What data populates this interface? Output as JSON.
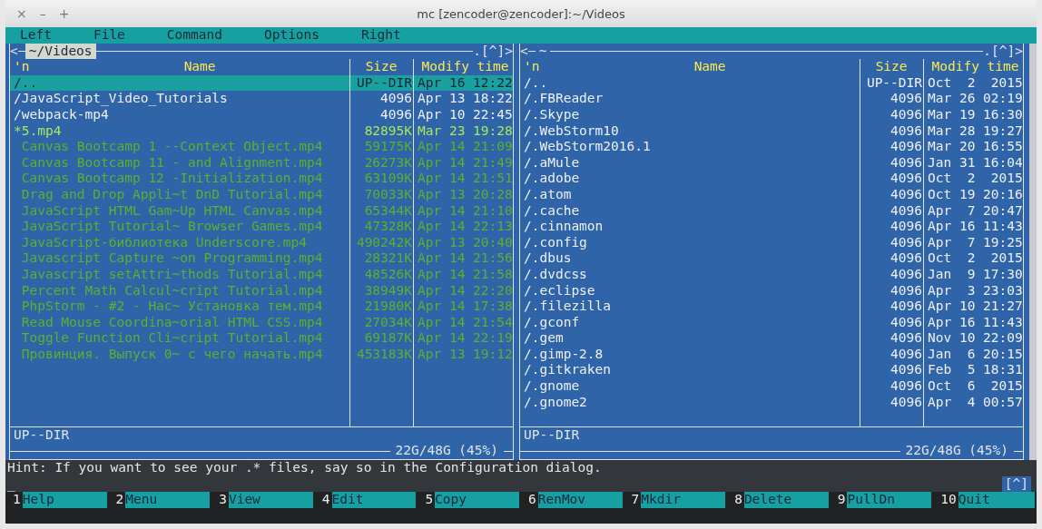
{
  "window": {
    "title": "mc [zencoder@zencoder]:~/Videos",
    "controls": [
      {
        "label": "×"
      },
      {
        "label": "–"
      },
      {
        "label": "+"
      }
    ]
  },
  "menu": [
    {
      "label": "Left"
    },
    {
      "label": "File"
    },
    {
      "label": "Command"
    },
    {
      "label": "Options"
    },
    {
      "label": "Right"
    }
  ],
  "panels": [
    {
      "path": "~/Videos",
      "active": true,
      "back": "<",
      "history": ".[^]",
      "forward": ">",
      "columns": [
        "'n",
        "Name",
        "Size",
        "Modify time"
      ],
      "status": "UP--DIR",
      "disk": "22G/48G (45%)",
      "rows": [
        {
          "name": "/..",
          "size": "UP--DIR",
          "modified": "Apr 16 12:22",
          "kind": "directory",
          "selected": true
        },
        {
          "name": "/JavaScript_Video_Tutorials",
          "size": "4096",
          "modified": "Apr 13 18:22",
          "kind": "directory",
          "selected": false
        },
        {
          "name": "/webpack-mp4",
          "size": "4096",
          "modified": "Apr 10 22:45",
          "kind": "directory",
          "selected": false
        },
        {
          "name": "*5.mp4",
          "size": "82895K",
          "modified": "Mar 23 19:28",
          "kind": "executable",
          "selected": false
        },
        {
          "name": "Canvas Bootcamp 1 --Context Object.mp4",
          "size": "59175K",
          "modified": "Apr 14 21:09",
          "kind": "media",
          "selected": false
        },
        {
          "name": "Canvas Bootcamp 11 - and Alignment.mp4",
          "size": "26273K",
          "modified": "Apr 14 21:49",
          "kind": "media",
          "selected": false
        },
        {
          "name": "Canvas Bootcamp 12 -Initialization.mp4",
          "size": "63109K",
          "modified": "Apr 14 21:51",
          "kind": "media",
          "selected": false
        },
        {
          "name": "Drag and Drop Appli~t DnD Tutorial.mp4",
          "size": "70033K",
          "modified": "Apr 13 20:28",
          "kind": "media",
          "selected": false
        },
        {
          "name": "JavaScript HTML Gam~Up HTML Canvas.mp4",
          "size": "65344K",
          "modified": "Apr 14 21:10",
          "kind": "media",
          "selected": false
        },
        {
          "name": "JavaScript Tutorial~ Browser Games.mp4",
          "size": "47328K",
          "modified": "Apr 14 22:13",
          "kind": "media",
          "selected": false
        },
        {
          "name": "JavaScript-библиотека Underscore.mp4",
          "size": "490242K",
          "modified": "Apr 13 20:40",
          "kind": "media",
          "selected": false
        },
        {
          "name": "Javascript Capture ~on Programming.mp4",
          "size": "28321K",
          "modified": "Apr 14 21:56",
          "kind": "media",
          "selected": false
        },
        {
          "name": "Javascript setAttri~thods Tutorial.mp4",
          "size": "48526K",
          "modified": "Apr 14 21:58",
          "kind": "media",
          "selected": false
        },
        {
          "name": "Percent Math Calcul~cript Tutorial.mp4",
          "size": "38949K",
          "modified": "Apr 14 22:20",
          "kind": "media",
          "selected": false
        },
        {
          "name": "PhpStorm - #2 - Нас~ Установка тем.mp4",
          "size": "21980K",
          "modified": "Apr 14 17:38",
          "kind": "media",
          "selected": false
        },
        {
          "name": "Read Mouse Coordina~orial HTML CSS.mp4",
          "size": "27034K",
          "modified": "Apr 14 21:54",
          "kind": "media",
          "selected": false
        },
        {
          "name": "Toggle Function Cli~cript Tutorial.mp4",
          "size": "69187K",
          "modified": "Apr 14 22:19",
          "kind": "media",
          "selected": false
        },
        {
          "name": "Провинция. Выпуск 0~ с чего начать.mp4",
          "size": "453183K",
          "modified": "Apr 13 19:12",
          "kind": "media",
          "selected": false
        }
      ]
    },
    {
      "path": "~",
      "active": false,
      "back": "<",
      "history": ".[^]",
      "forward": ">",
      "columns": [
        "'n",
        "Name",
        "Size",
        "Modify time"
      ],
      "status": "UP--DIR",
      "disk": "22G/48G (45%)",
      "rows": [
        {
          "name": "/..",
          "size": "UP--DIR",
          "modified": "Oct  2  2015",
          "kind": "directory",
          "selected": false
        },
        {
          "name": "/.FBReader",
          "size": "4096",
          "modified": "Mar 26 02:19",
          "kind": "directory",
          "selected": false
        },
        {
          "name": "/.Skype",
          "size": "4096",
          "modified": "Mar 19 16:30",
          "kind": "directory",
          "selected": false
        },
        {
          "name": "/.WebStorm10",
          "size": "4096",
          "modified": "Mar 28 19:27",
          "kind": "directory",
          "selected": false
        },
        {
          "name": "/.WebStorm2016.1",
          "size": "4096",
          "modified": "Mar 20 16:55",
          "kind": "directory",
          "selected": false
        },
        {
          "name": "/.aMule",
          "size": "4096",
          "modified": "Jan 31 16:04",
          "kind": "directory",
          "selected": false
        },
        {
          "name": "/.adobe",
          "size": "4096",
          "modified": "Oct  2  2015",
          "kind": "directory",
          "selected": false
        },
        {
          "name": "/.atom",
          "size": "4096",
          "modified": "Oct 19 20:16",
          "kind": "directory",
          "selected": false
        },
        {
          "name": "/.cache",
          "size": "4096",
          "modified": "Apr  7 20:47",
          "kind": "directory",
          "selected": false
        },
        {
          "name": "/.cinnamon",
          "size": "4096",
          "modified": "Apr 16 11:43",
          "kind": "directory",
          "selected": false
        },
        {
          "name": "/.config",
          "size": "4096",
          "modified": "Apr  7 19:25",
          "kind": "directory",
          "selected": false
        },
        {
          "name": "/.dbus",
          "size": "4096",
          "modified": "Oct  2  2015",
          "kind": "directory",
          "selected": false
        },
        {
          "name": "/.dvdcss",
          "size": "4096",
          "modified": "Jan  9 17:30",
          "kind": "directory",
          "selected": false
        },
        {
          "name": "/.eclipse",
          "size": "4096",
          "modified": "Apr  3 23:03",
          "kind": "directory",
          "selected": false
        },
        {
          "name": "/.filezilla",
          "size": "4096",
          "modified": "Apr 10 21:27",
          "kind": "directory",
          "selected": false
        },
        {
          "name": "/.gconf",
          "size": "4096",
          "modified": "Apr 16 11:43",
          "kind": "directory",
          "selected": false
        },
        {
          "name": "/.gem",
          "size": "4096",
          "modified": "Nov 10 22:09",
          "kind": "directory",
          "selected": false
        },
        {
          "name": "/.gimp-2.8",
          "size": "4096",
          "modified": "Jan  6 20:15",
          "kind": "directory",
          "selected": false
        },
        {
          "name": "/.gitkraken",
          "size": "4096",
          "modified": "Feb  5 18:31",
          "kind": "directory",
          "selected": false
        },
        {
          "name": "/.gnome",
          "size": "4096",
          "modified": "Oct  6  2015",
          "kind": "directory",
          "selected": false
        },
        {
          "name": "/.gnome2",
          "size": "4096",
          "modified": "Apr  4 00:57",
          "kind": "directory",
          "selected": false
        }
      ]
    }
  ],
  "hint": "Hint: If you want to see your .* files, say so in the Configuration dialog.",
  "prompt": {
    "cursor": "_",
    "button": "[^]"
  },
  "function_keys": [
    {
      "number": "1",
      "label": "Help"
    },
    {
      "number": "2",
      "label": "Menu"
    },
    {
      "number": "3",
      "label": "View"
    },
    {
      "number": "4",
      "label": "Edit"
    },
    {
      "number": "5",
      "label": "Copy"
    },
    {
      "number": "6",
      "label": "RenMov"
    },
    {
      "number": "7",
      "label": "Mkdir"
    },
    {
      "number": "8",
      "label": "Delete"
    },
    {
      "number": "9",
      "label": "PullDn"
    },
    {
      "number": "10",
      "label": "Quit"
    }
  ]
}
